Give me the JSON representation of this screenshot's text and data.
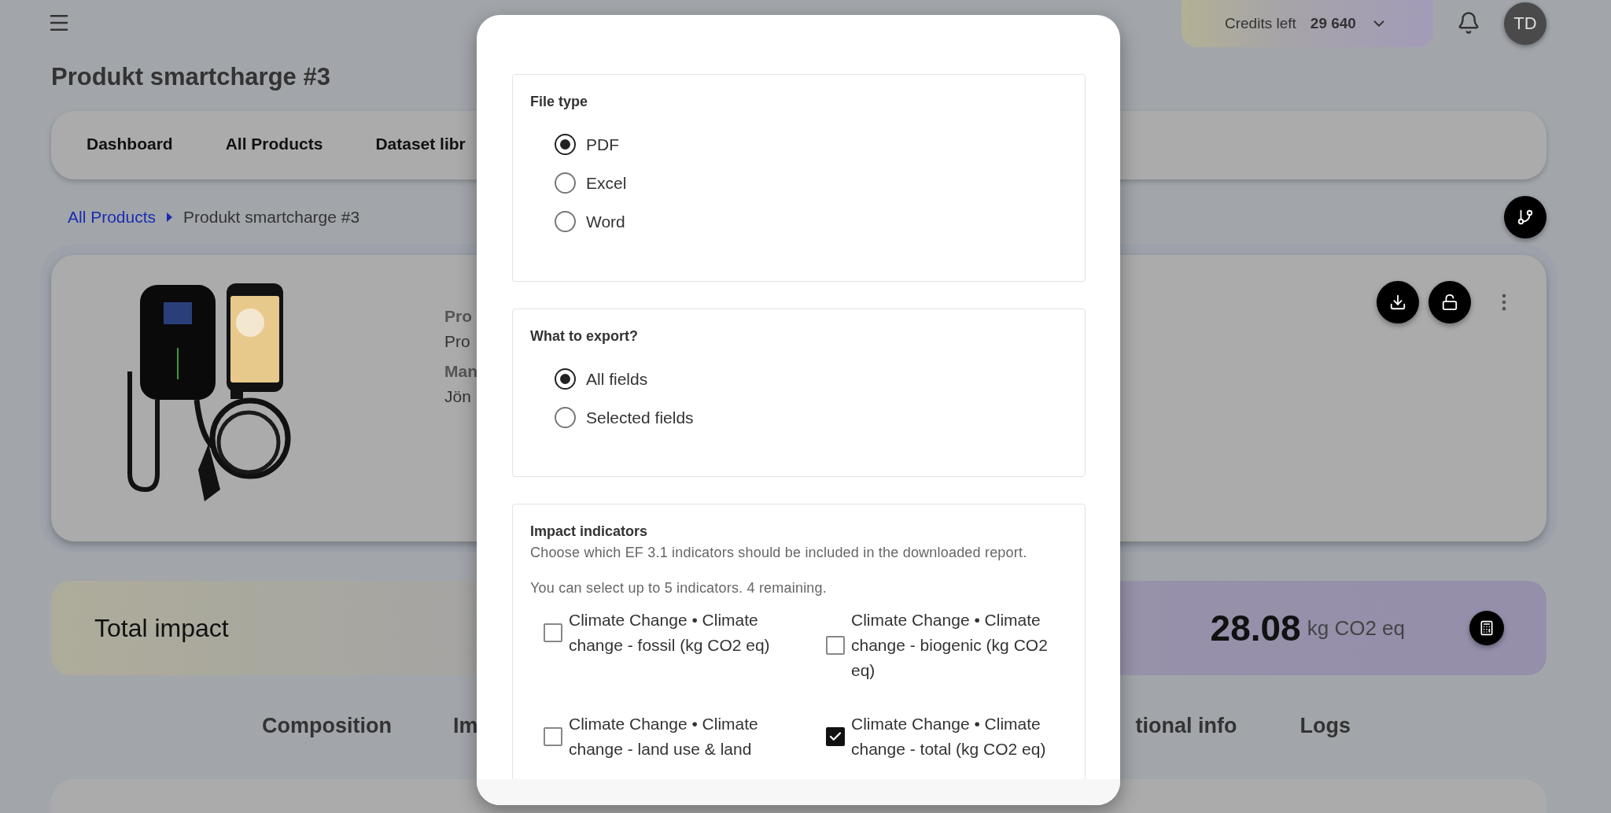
{
  "top_bar": {
    "credits_label": "Credits left",
    "credits_value": "29 640",
    "avatar_initials": "TD"
  },
  "page_title": "Produkt smartcharge #3",
  "nav_tabs": [
    {
      "label": "Dashboard",
      "selected": false
    },
    {
      "label": "All Products",
      "selected": false
    },
    {
      "label": "Dataset libr",
      "selected": false
    }
  ],
  "breadcrumb": [
    "All Products",
    "Produkt smartcharge #3"
  ],
  "product_card": {
    "fields": [
      {
        "label": "Pro",
        "value": "Pro"
      },
      {
        "label": "Man",
        "value": "Jön"
      }
    ]
  },
  "total_impact": {
    "label": "Total impact",
    "value": "28.08",
    "unit": "kg CO2 eq"
  },
  "section_tabs": [
    {
      "label": "Composition",
      "selected": false
    },
    {
      "label": "Im",
      "selected": false
    },
    {
      "label": "tional info",
      "selected": false
    },
    {
      "label": "Logs",
      "selected": false
    }
  ],
  "export_dialog": {
    "file_type": {
      "title": "File type",
      "options": [
        {
          "label": "PDF",
          "selected": true
        },
        {
          "label": "Excel",
          "selected": false
        },
        {
          "label": "Word",
          "selected": false
        }
      ]
    },
    "what_to_export": {
      "title": "What to export?",
      "options": [
        {
          "label": "All fields",
          "selected": true
        },
        {
          "label": "Selected fields",
          "selected": false
        }
      ]
    },
    "impact_indicators": {
      "title": "Impact indicators",
      "description": "Choose which EF 3.1 indicators should be included in the downloaded report.",
      "limit_note": "You can select up to 5 indicators. 4 remaining.",
      "indicators": [
        {
          "label": "Climate Change • Climate change - fossil (kg CO2 eq)",
          "checked": false
        },
        {
          "label": "Climate Change • Climate change - biogenic (kg CO2 eq)",
          "checked": false
        },
        {
          "label": "Climate Change • Climate change - land use & land",
          "checked": false
        },
        {
          "label": "Climate Change • Climate change - total (kg CO2 eq)",
          "checked": true
        }
      ]
    }
  }
}
